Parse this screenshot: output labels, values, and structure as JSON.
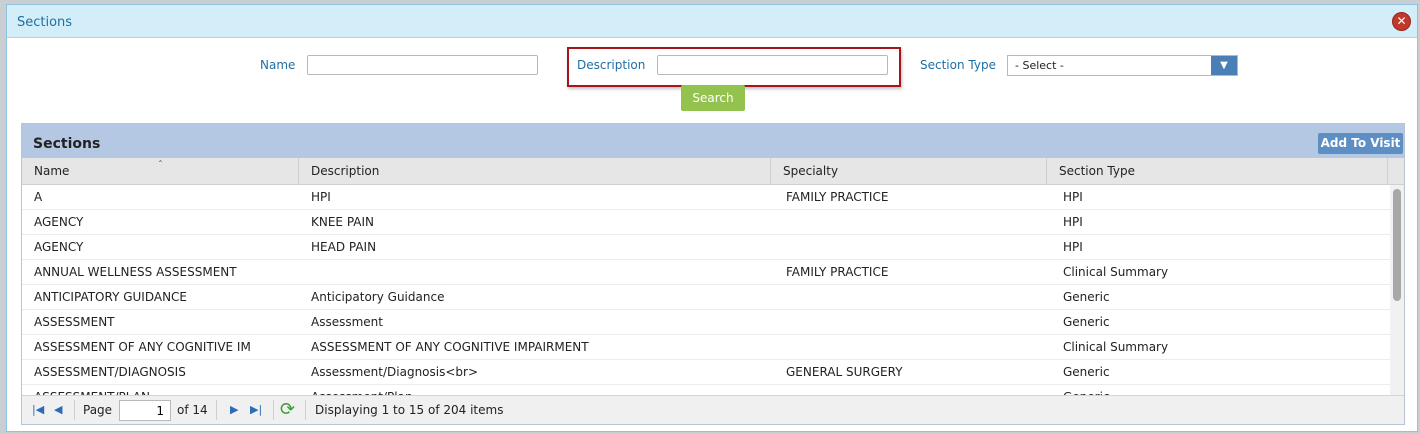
{
  "dialog": {
    "title": "Sections",
    "close_icon": "close-icon"
  },
  "filters": {
    "name_label": "Name",
    "name_value": "",
    "description_label": "Description",
    "description_value": "",
    "section_type_label": "Section Type",
    "section_type_selected": "- Select -",
    "search_label": "Search"
  },
  "grid": {
    "title": "Sections",
    "add_to_visit_label": "Add To Visit",
    "columns": [
      "Name",
      "Description",
      "Specialty",
      "Section Type"
    ],
    "rows": [
      {
        "name": "A",
        "description": "HPI",
        "specialty": "FAMILY PRACTICE",
        "section_type": "HPI"
      },
      {
        "name": "AGENCY",
        "description": "KNEE PAIN",
        "specialty": "",
        "section_type": "HPI"
      },
      {
        "name": "AGENCY",
        "description": "HEAD PAIN",
        "specialty": "",
        "section_type": "HPI"
      },
      {
        "name": "ANNUAL WELLNESS ASSESSMENT",
        "description": "",
        "specialty": "FAMILY PRACTICE",
        "section_type": "Clinical Summary"
      },
      {
        "name": "ANTICIPATORY GUIDANCE",
        "description": "Anticipatory Guidance",
        "specialty": "",
        "section_type": "Generic"
      },
      {
        "name": "ASSESSMENT",
        "description": "Assessment",
        "specialty": "",
        "section_type": "Generic"
      },
      {
        "name": "ASSESSMENT OF ANY COGNITIVE IM",
        "description": "ASSESSMENT OF ANY COGNITIVE IMPAIRMENT",
        "specialty": "",
        "section_type": "Clinical Summary"
      },
      {
        "name": "ASSESSMENT/DIAGNOSIS",
        "description": "Assessment/Diagnosis<br>",
        "specialty": "GENERAL SURGERY",
        "section_type": "Generic"
      },
      {
        "name": "ASSESSMENT/PLAN",
        "description": "Assessment/Plan",
        "specialty": "",
        "section_type": "Generic"
      }
    ]
  },
  "pager": {
    "page_label": "Page",
    "page_value": "1",
    "of_label": "of 14",
    "displaying": "Displaying 1 to 15 of 204 items"
  }
}
